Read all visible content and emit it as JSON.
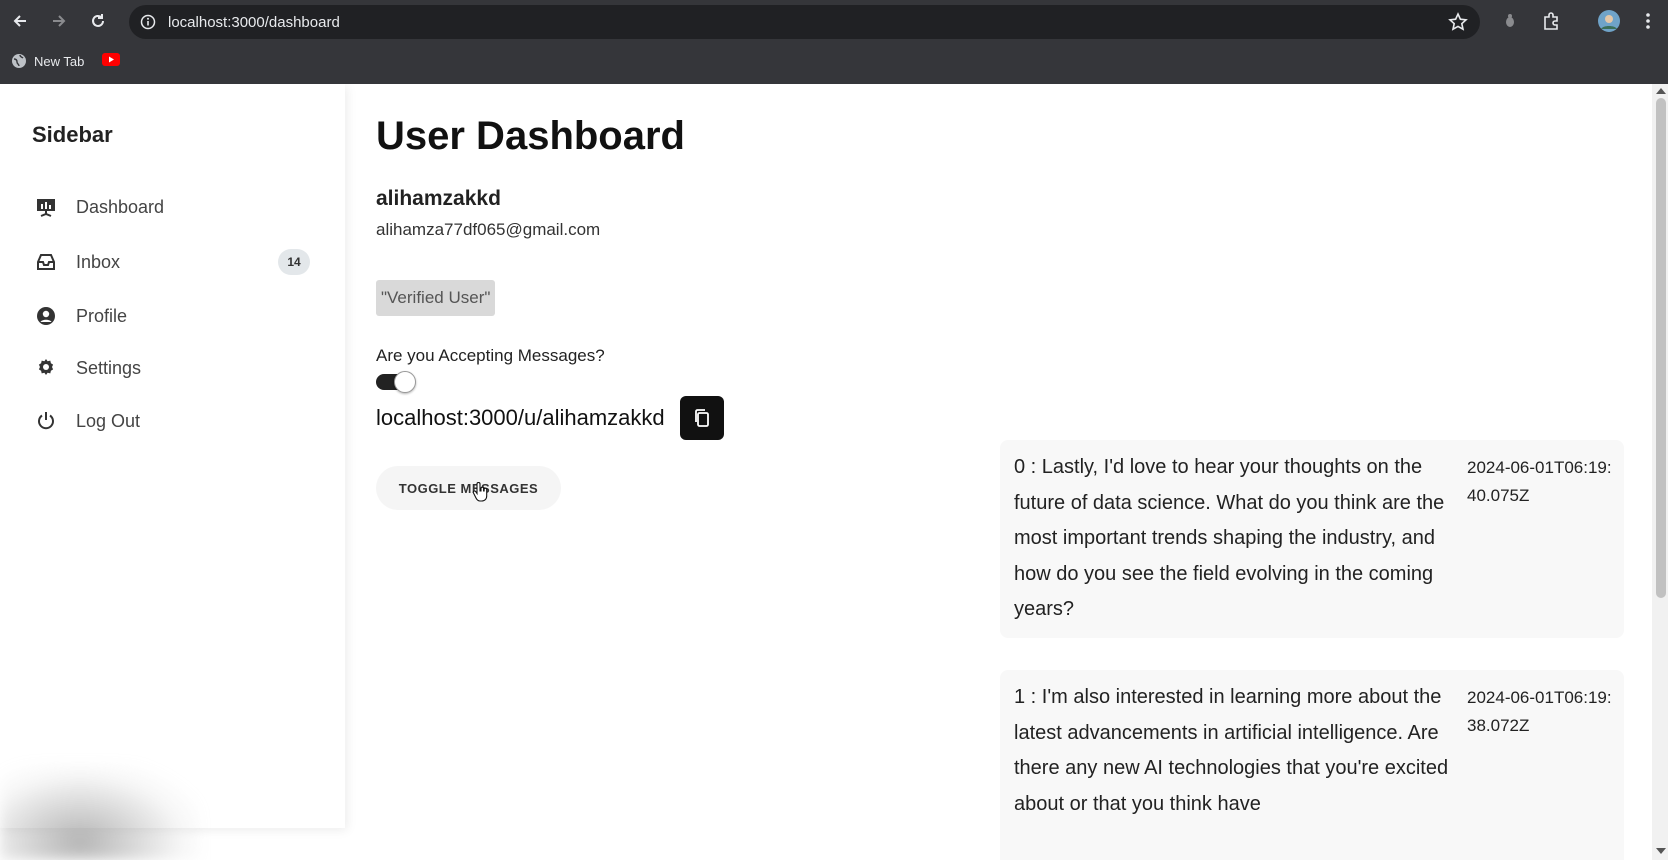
{
  "browser": {
    "url": "localhost:3000/dashboard",
    "bookmarks": [
      {
        "label": "New Tab"
      },
      {
        "label": ""
      }
    ]
  },
  "sidebar": {
    "title": "Sidebar",
    "items": [
      {
        "label": "Dashboard",
        "icon": "dashboard-icon"
      },
      {
        "label": "Inbox",
        "icon": "inbox-icon",
        "badge": "14"
      },
      {
        "label": "Profile",
        "icon": "profile-icon"
      },
      {
        "label": "Settings",
        "icon": "gear-icon"
      },
      {
        "label": "Log Out",
        "icon": "power-icon"
      }
    ]
  },
  "main": {
    "title": "User Dashboard",
    "username": "alihamzakkd",
    "email": "alihamza77df065@gmail.com",
    "verified_label": "\"Verified User\"",
    "accepting_question": "Are you Accepting Messages?",
    "accepting_enabled": true,
    "profile_link": "localhost:3000/u/alihamzakkd",
    "toggle_button": "TOGGLE MESSAGES"
  },
  "messages": [
    {
      "text": "0 : Lastly, I'd love to hear your thoughts on the future of data science. What do you think are the most important trends shaping the industry, and how do you see the field evolving in the coming years?",
      "date": "2024-06-01T06:19:40.075Z"
    },
    {
      "text": "1 : I'm also interested in learning more about the latest advancements in artificial intelligence. Are there any new AI technologies that you're excited about or that you think have",
      "date": "2024-06-01T06:19:38.072Z"
    }
  ],
  "colors": {
    "chrome_bg": "#35363a",
    "omnibox_bg": "#202124",
    "accent_dark": "#111111",
    "badge_bg": "#e3e7ea",
    "verified_bg": "#d9d9d9",
    "message_bg": "#f8f8f8"
  }
}
